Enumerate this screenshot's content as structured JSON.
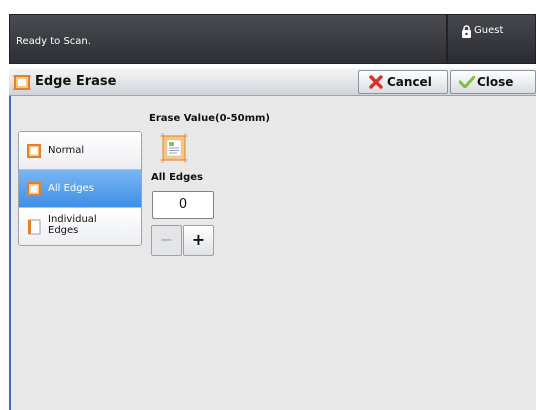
{
  "status": {
    "message": "Ready to Scan."
  },
  "user": {
    "label": "Guest"
  },
  "header": {
    "title": "Edge Erase",
    "cancel_label": "Cancel",
    "close_label": "Close"
  },
  "options": {
    "normal": "Normal",
    "all_edges": "All Edges",
    "individual_edges_line1": "Individual",
    "individual_edges_line2": "Edges",
    "selected": "All Edges"
  },
  "erase": {
    "title": "Erase Value(0-50mm)",
    "edge_label": "All Edges",
    "value": "0"
  },
  "stepper": {
    "minus": "−",
    "plus": "+"
  },
  "colors": {
    "accent": "#3e8fe6",
    "edge_icon": "#e2802c",
    "cancel": "#d6312a",
    "check": "#7cc23a"
  }
}
